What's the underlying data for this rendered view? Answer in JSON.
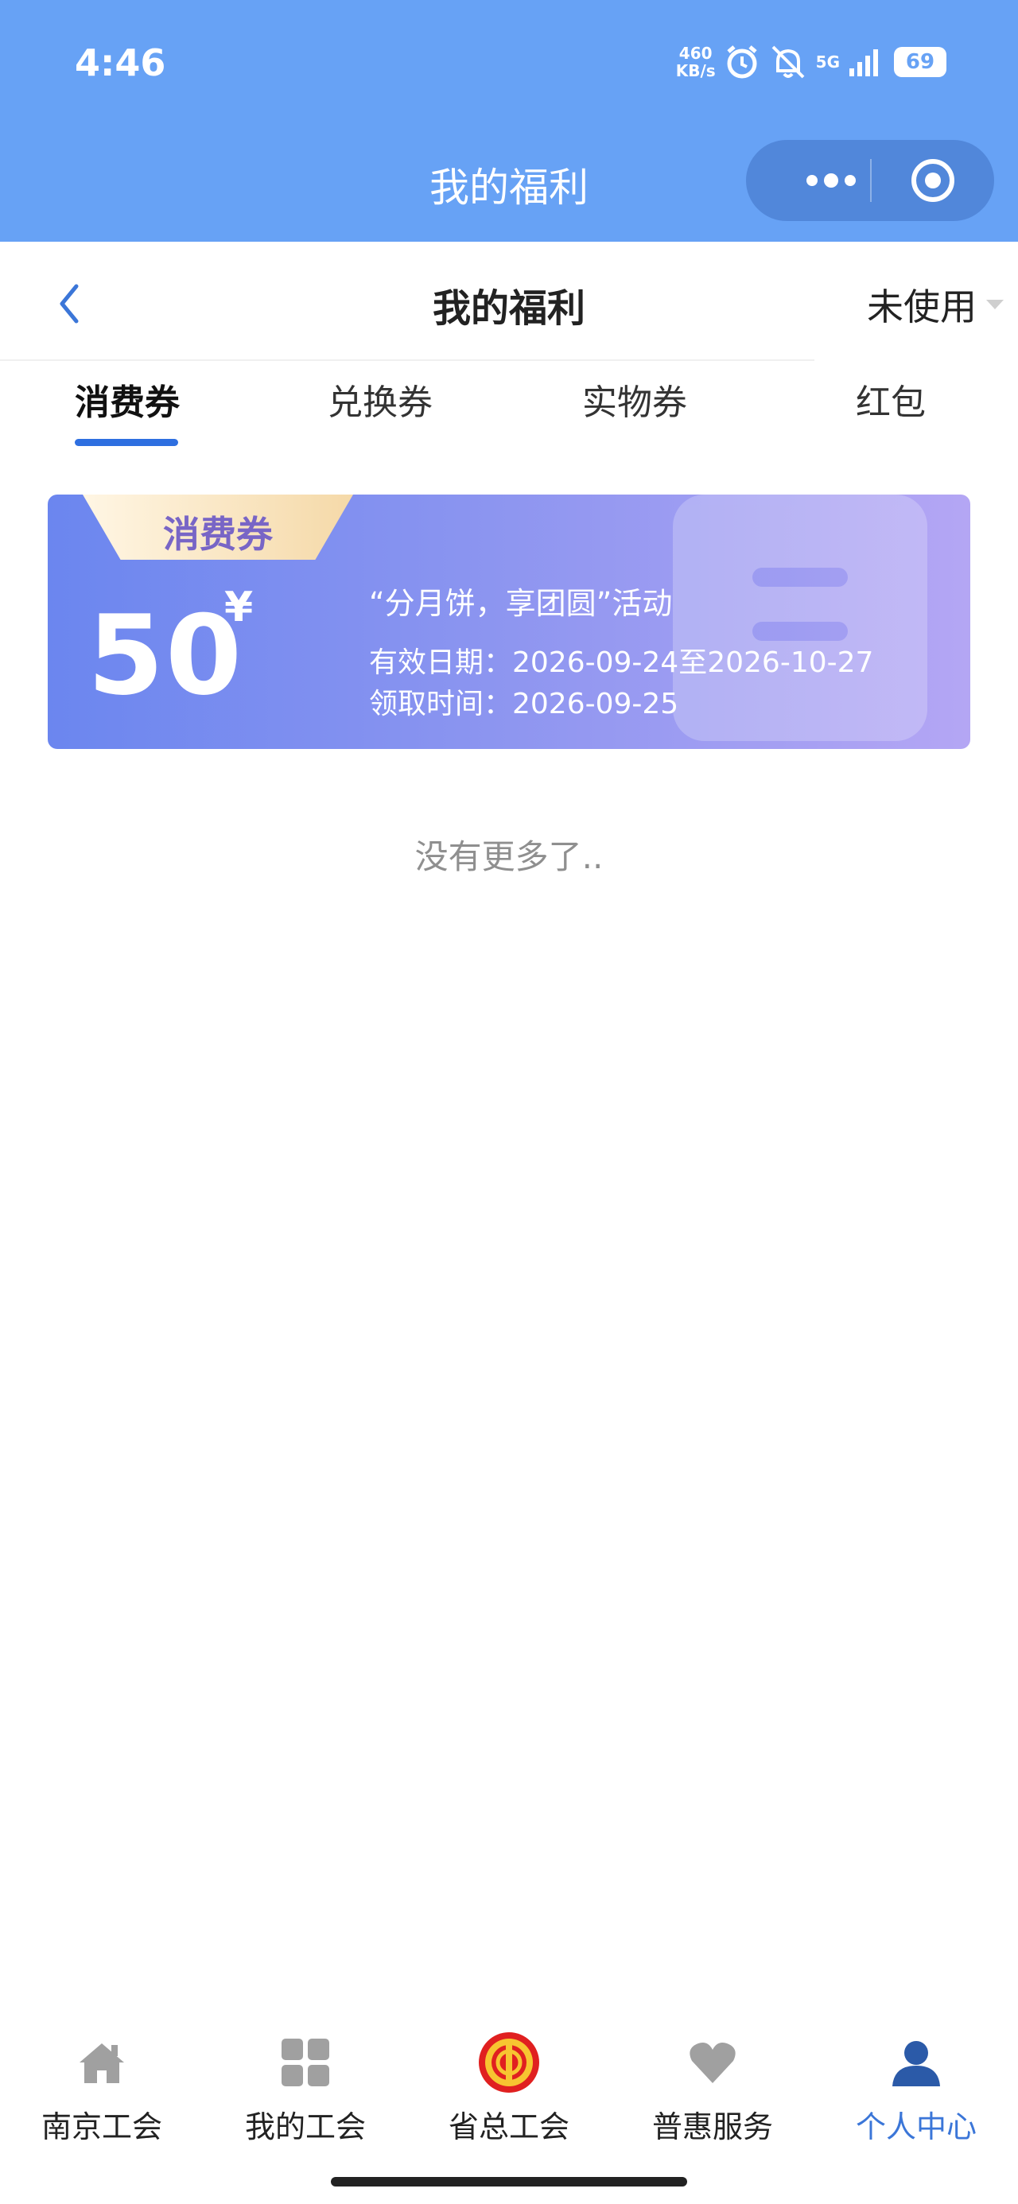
{
  "status_bar": {
    "time": "4:46",
    "speed_value": "460",
    "speed_unit": "KB/s",
    "network": "5G",
    "battery": "69"
  },
  "miniprogram": {
    "title": "我的福利"
  },
  "header": {
    "title": "我的福利",
    "filter_label": "未使用"
  },
  "tabs": [
    {
      "label": "消费券",
      "active": true
    },
    {
      "label": "兑换券",
      "active": false
    },
    {
      "label": "实物券",
      "active": false
    },
    {
      "label": "红包",
      "active": false
    }
  ],
  "coupons": [
    {
      "tag": "消费券",
      "amount": "50",
      "currency": "¥",
      "name": "“分月饼，享团圆”活动",
      "valid_period": "有效日期：2026-09-24至2026-10-27",
      "received_time": "领取时间：2026-09-25"
    }
  ],
  "list_end_text": "没有更多了..",
  "bottom_nav": [
    {
      "label": "南京工会",
      "icon": "home-icon",
      "active": false
    },
    {
      "label": "我的工会",
      "icon": "grid-icon",
      "active": false
    },
    {
      "label": "省总工会",
      "icon": "union-emblem-icon",
      "active": false
    },
    {
      "label": "普惠服务",
      "icon": "heart-icon",
      "active": false
    },
    {
      "label": "个人中心",
      "icon": "person-icon",
      "active": true
    }
  ],
  "colors": {
    "top_bar": "#67a2f5",
    "accent": "#2e6fe0",
    "active_nav": "#3b76d8",
    "coupon_start": "#6b86ef",
    "coupon_end": "#b4a6f4"
  }
}
